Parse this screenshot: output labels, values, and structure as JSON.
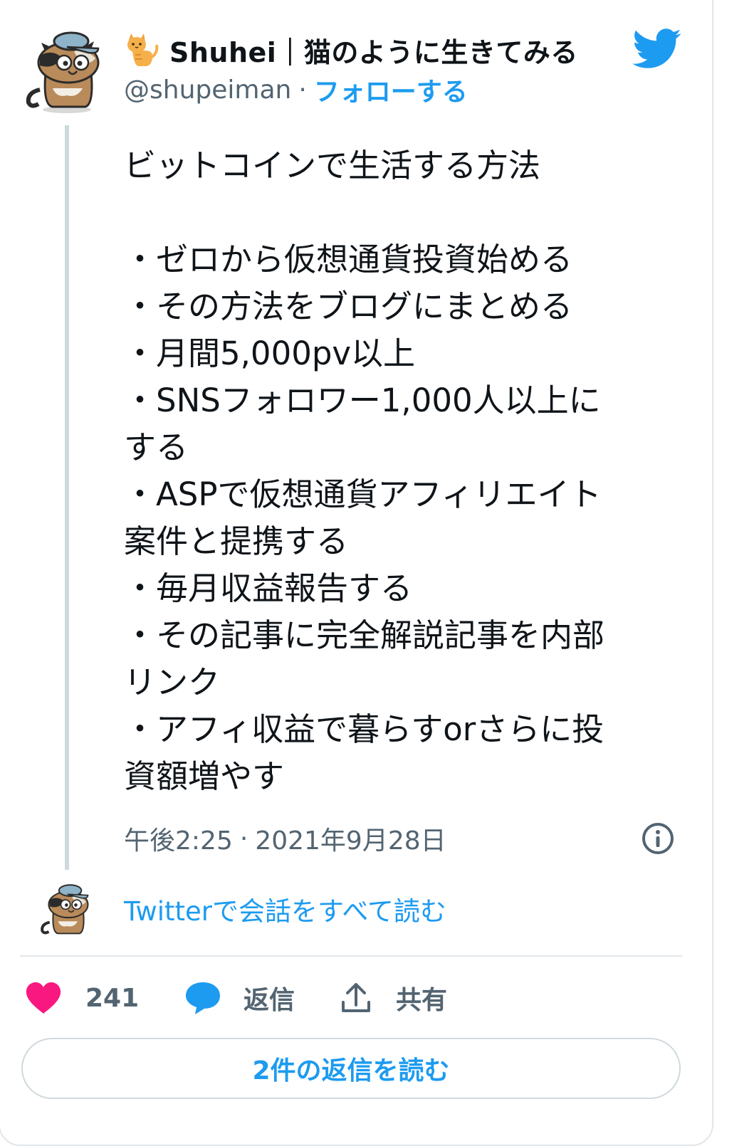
{
  "author": {
    "display_name": "Shuhei｜猫のように生きてみる",
    "handle": "@shupeiman",
    "separator": "·",
    "follow_label": "フォローする",
    "avatar_icon": "calico-cat-with-cap-avatar",
    "name_emoji_icon": "cat-emoji-icon"
  },
  "tweet": {
    "lines": [
      "ビットコインで生活する方法",
      "",
      "・ゼロから仮想通貨投資始める",
      "・その方法をブログにまとめる",
      "・月間5,000pv以上",
      "・SNSフォロワー1,000人以上に",
      "する",
      "・ASPで仮想通貨アフィリエイト",
      "案件と提携する",
      "・毎月収益報告する",
      "・その記事に完全解説記事を内部",
      "リンク",
      "・アフィ収益で暮らすorさらに投",
      "資額増やす"
    ],
    "time": "午後2:25",
    "date_separator": "·",
    "date": "2021年9月28日"
  },
  "conversation": {
    "read_all_label": "Twitterで会話をすべて読む"
  },
  "actions": {
    "like_count": "241",
    "reply_label": "返信",
    "share_label": "共有"
  },
  "replies_button": {
    "label": "2件の返信を読む"
  },
  "colors": {
    "accent": "#1d9bf0",
    "like": "#f91880",
    "muted": "#536471",
    "border": "#cfd9de"
  }
}
